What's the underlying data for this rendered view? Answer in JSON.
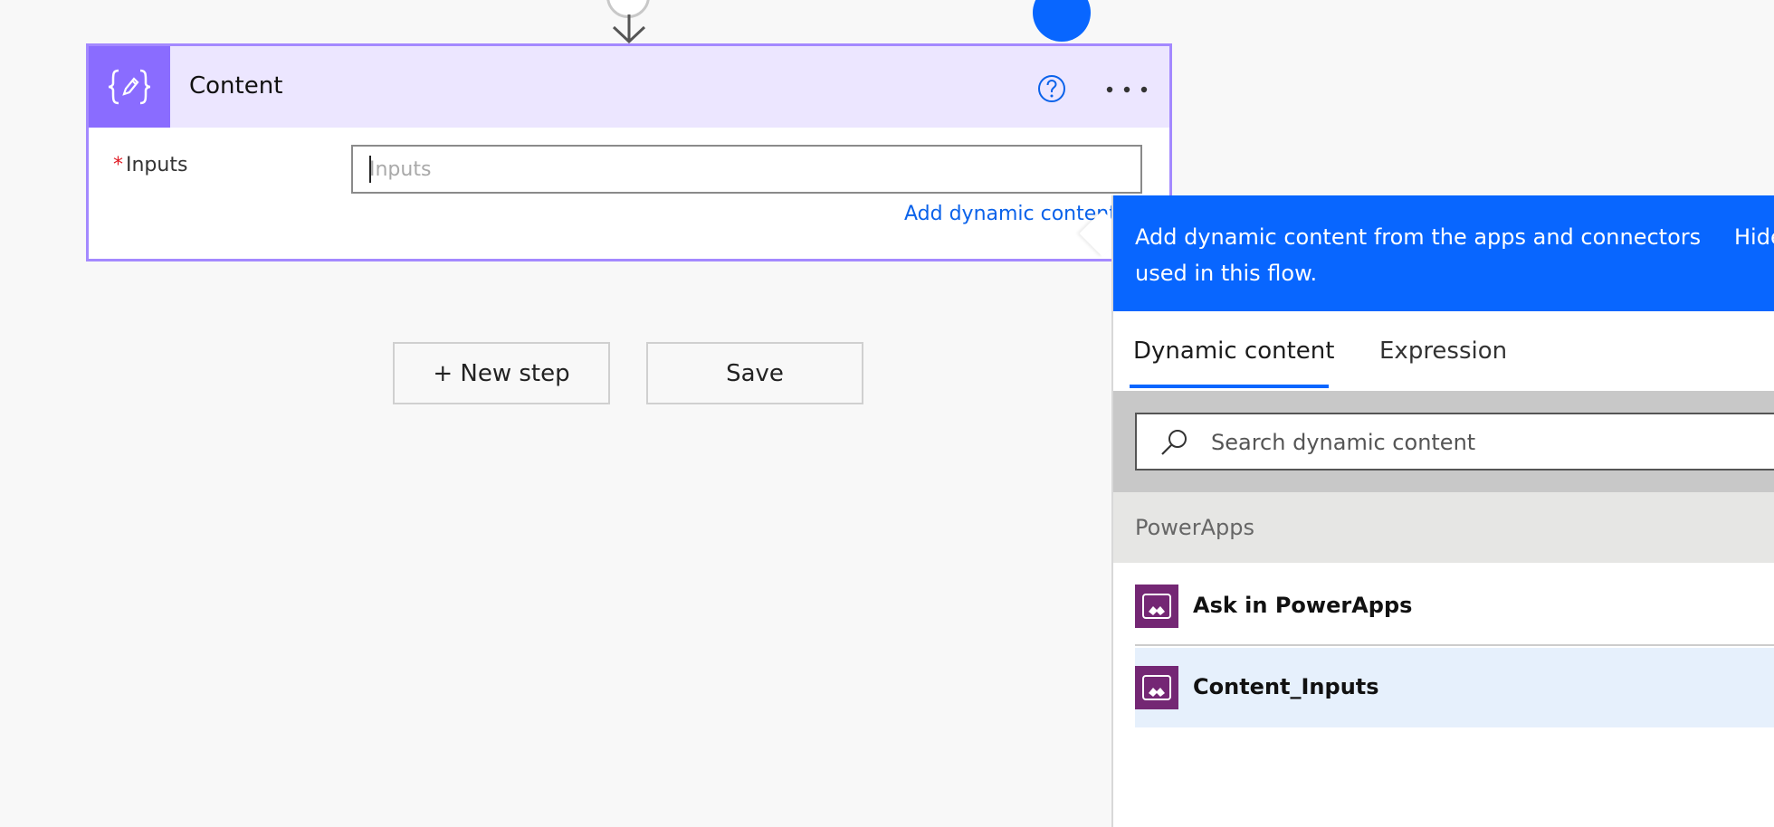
{
  "action_card": {
    "title": "Content",
    "icon": "code-braces-edit-icon",
    "help_icon": "help-circle-icon",
    "more_icon": "more-horizontal-icon",
    "field": {
      "label": "Inputs",
      "required_marker": "*",
      "placeholder": "Inputs",
      "value": ""
    },
    "add_dynamic_label": "Add dynamic content"
  },
  "toolbar": {
    "new_step_label": "+ New step",
    "save_label": "Save"
  },
  "dynamic_panel": {
    "banner_text": "Add dynamic content from the apps and connectors used in this flow.",
    "hide_label": "Hide",
    "tabs": [
      {
        "label": "Dynamic content",
        "active": true
      },
      {
        "label": "Expression",
        "active": false
      }
    ],
    "search": {
      "placeholder": "Search dynamic content",
      "value": ""
    },
    "group": {
      "title": "PowerApps",
      "items": [
        {
          "label": "Ask in PowerApps",
          "icon": "powerapps-icon",
          "selected": false
        },
        {
          "label": "Content_Inputs",
          "icon": "powerapps-icon",
          "selected": true
        }
      ]
    }
  },
  "colors": {
    "accent_blue": "#0866ff",
    "card_border": "#a489ff",
    "card_header": "#ece6ff",
    "card_icon_tile": "#8a6cff",
    "powerapps_purple": "#742774",
    "required_red": "#e01b24",
    "selected_row": "#e6f0fc"
  }
}
